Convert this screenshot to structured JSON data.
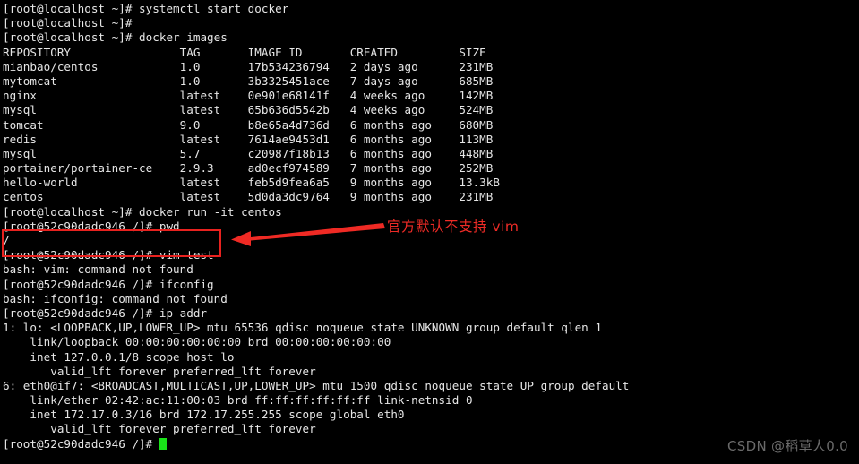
{
  "terminal": {
    "background_color": "#000000",
    "text_color": "#e6e6e6",
    "cursor_color": "#19e219",
    "host_prompt": "[root@localhost ~]#",
    "container_prompt": "[root@52c90dadc946 /]#",
    "lines": [
      "[root@localhost ~]# systemctl start docker",
      "[root@localhost ~]#",
      "[root@localhost ~]# docker images",
      "REPOSITORY                TAG       IMAGE ID       CREATED         SIZE",
      "mianbao/centos            1.0       17b534236794   2 days ago      231MB",
      "mytomcat                  1.0       3b3325451ace   7 days ago      685MB",
      "nginx                     latest    0e901e68141f   4 weeks ago     142MB",
      "mysql                     latest    65b636d5542b   4 weeks ago     524MB",
      "tomcat                    9.0       b8e65a4d736d   6 months ago    680MB",
      "redis                     latest    7614ae9453d1   6 months ago    113MB",
      "mysql                     5.7       c20987f18b13   6 months ago    448MB",
      "portainer/portainer-ce    2.9.3     ad0ecf974589   7 months ago    252MB",
      "hello-world               latest    feb5d9fea6a5   9 months ago    13.3kB",
      "centos                    latest    5d0da3dc9764   9 months ago    231MB",
      "[root@localhost ~]# docker run -it centos",
      "[root@52c90dadc946 /]# pwd",
      "/",
      "[root@52c90dadc946 /]# vim test",
      "bash: vim: command not found",
      "[root@52c90dadc946 /]# ifconfig",
      "bash: ifconfig: command not found",
      "[root@52c90dadc946 /]# ip addr",
      "1: lo: <LOOPBACK,UP,LOWER_UP> mtu 65536 qdisc noqueue state UNKNOWN group default qlen 1",
      "    link/loopback 00:00:00:00:00:00 brd 00:00:00:00:00:00",
      "    inet 127.0.0.1/8 scope host lo",
      "       valid_lft forever preferred_lft forever",
      "6: eth0@if7: <BROADCAST,MULTICAST,UP,LOWER_UP> mtu 1500 qdisc noqueue state UP group default",
      "    link/ether 02:42:ac:11:00:03 brd ff:ff:ff:ff:ff:ff link-netnsid 0",
      "    inet 172.17.0.3/16 brd 172.17.255.255 scope global eth0",
      "       valid_lft forever preferred_lft forever"
    ],
    "prompt_last": "[root@52c90dadc946 /]# "
  },
  "commands": [
    "systemctl start docker",
    "docker images",
    "docker run -it centos",
    "pwd",
    "vim test",
    "ifconfig",
    "ip addr"
  ],
  "docker_images_table": {
    "headers": [
      "REPOSITORY",
      "TAG",
      "IMAGE ID",
      "CREATED",
      "SIZE"
    ],
    "rows": [
      [
        "mianbao/centos",
        "1.0",
        "17b534236794",
        "2 days ago",
        "231MB"
      ],
      [
        "mytomcat",
        "1.0",
        "3b3325451ace",
        "7 days ago",
        "685MB"
      ],
      [
        "nginx",
        "latest",
        "0e901e68141f",
        "4 weeks ago",
        "142MB"
      ],
      [
        "mysql",
        "latest",
        "65b636d5542b",
        "4 weeks ago",
        "524MB"
      ],
      [
        "tomcat",
        "9.0",
        "b8e65a4d736d",
        "6 months ago",
        "680MB"
      ],
      [
        "redis",
        "latest",
        "7614ae9453d1",
        "6 months ago",
        "113MB"
      ],
      [
        "mysql",
        "5.7",
        "c20987f18b13",
        "6 months ago",
        "448MB"
      ],
      [
        "portainer/portainer-ce",
        "2.9.3",
        "ad0ecf974589",
        "7 months ago",
        "252MB"
      ],
      [
        "hello-world",
        "latest",
        "feb5d9fea6a5",
        "9 months ago",
        "13.3kB"
      ],
      [
        "centos",
        "latest",
        "5d0da3dc9764",
        "9 months ago",
        "231MB"
      ]
    ]
  },
  "annotation": {
    "text": "官方默认不支持 vim",
    "color": "#ee2b26",
    "highlighted_lines": [
      "[root@52c90dadc946 /]# vim test",
      "bash: vim: command not found"
    ]
  },
  "watermark": {
    "text": "CSDN @稻草人0.0",
    "color": "#6a6a6a"
  }
}
